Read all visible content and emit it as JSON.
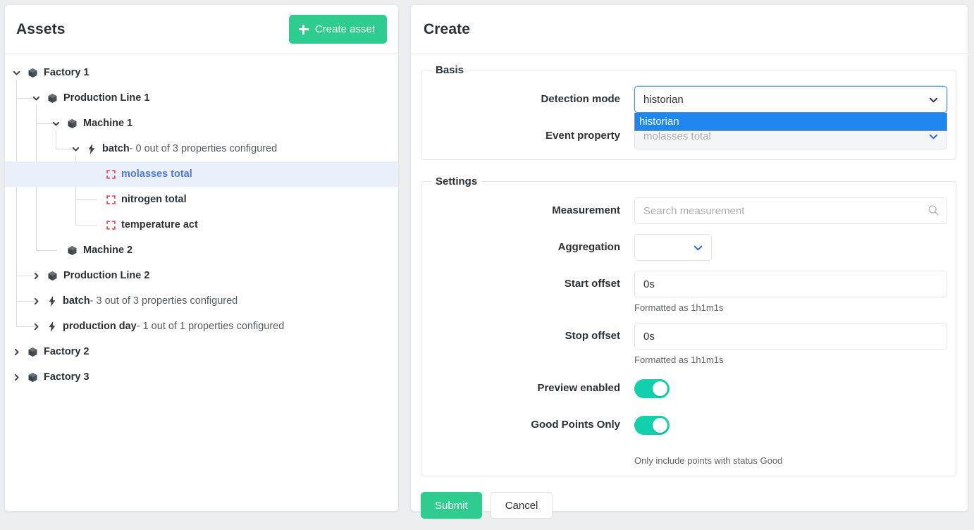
{
  "assets_panel": {
    "title": "Assets",
    "create_button": "Create asset",
    "create_icon": "plus-icon",
    "tree": [
      {
        "id": "factory1",
        "depth": 0,
        "icon": "cube-icon",
        "twisty": "chevron-down-icon",
        "label": "Factory 1",
        "suffix": ""
      },
      {
        "id": "pline1",
        "depth": 1,
        "icon": "cube-icon",
        "twisty": "chevron-down-icon",
        "label": "Production Line 1",
        "suffix": ""
      },
      {
        "id": "machine1",
        "depth": 2,
        "icon": "cube-icon",
        "twisty": "chevron-down-icon",
        "label": "Machine 1",
        "suffix": ""
      },
      {
        "id": "batch1",
        "depth": 3,
        "icon": "bolt-icon",
        "twisty": "chevron-down-icon",
        "label": "batch",
        "suffix": " - 0 out of 3 properties configured"
      },
      {
        "id": "molasses",
        "depth": 4,
        "icon": "property-icon",
        "twisty": "",
        "label": "molasses total",
        "suffix": "",
        "selected": true
      },
      {
        "id": "nitrogen",
        "depth": 4,
        "icon": "property-icon",
        "twisty": "",
        "label": "nitrogen total",
        "suffix": ""
      },
      {
        "id": "temp",
        "depth": 4,
        "icon": "property-icon",
        "twisty": "",
        "label": "temperature act",
        "suffix": ""
      },
      {
        "id": "machine2",
        "depth": 2,
        "icon": "cube-icon",
        "twisty": "",
        "label": "Machine 2",
        "suffix": ""
      },
      {
        "id": "pline2",
        "depth": 1,
        "icon": "cube-icon",
        "twisty": "chevron-right-icon",
        "label": "Production Line 2",
        "suffix": ""
      },
      {
        "id": "batch2",
        "depth": 1,
        "icon": "bolt-icon",
        "twisty": "chevron-right-icon",
        "label": "batch",
        "suffix": " - 3 out of 3 properties configured"
      },
      {
        "id": "prodday",
        "depth": 1,
        "icon": "bolt-icon",
        "twisty": "chevron-right-icon",
        "label": "production day",
        "suffix": " - 1 out of 1 properties configured"
      },
      {
        "id": "factory2",
        "depth": 0,
        "icon": "cube-icon",
        "twisty": "chevron-right-icon",
        "label": "Factory 2",
        "suffix": ""
      },
      {
        "id": "factory3",
        "depth": 0,
        "icon": "cube-icon",
        "twisty": "chevron-right-icon",
        "label": "Factory 3",
        "suffix": ""
      }
    ]
  },
  "create_panel": {
    "title": "Create",
    "basis": {
      "legend": "Basis",
      "detection_mode": {
        "label": "Detection mode",
        "value": "historian",
        "open": true,
        "options": [
          "historian"
        ],
        "selected_option": "historian"
      },
      "event_property": {
        "label": "Event property",
        "value": "molasses total",
        "disabled": true
      }
    },
    "settings": {
      "legend": "Settings",
      "measurement": {
        "label": "Measurement",
        "value": "",
        "placeholder": "Search measurement",
        "icon": "search-icon"
      },
      "aggregation": {
        "label": "Aggregation",
        "value": ""
      },
      "start_offset": {
        "label": "Start offset",
        "value": "0s",
        "hint": "Formatted as 1h1m1s"
      },
      "stop_offset": {
        "label": "Stop offset",
        "value": "0s",
        "hint": "Formatted as 1h1m1s"
      },
      "preview_enabled": {
        "label": "Preview enabled",
        "on": true
      },
      "good_points_only": {
        "label": "Good Points Only",
        "on": true,
        "hint": "Only include points with status Good"
      }
    },
    "submit_label": "Submit",
    "cancel_label": "Cancel"
  },
  "colors": {
    "accent_green": "#2ecc8f",
    "toggle_on": "#10d0ad",
    "focus_blue": "#4a90e8",
    "option_highlight": "#1f87f0",
    "selected_row": "#eaf0fb",
    "property_icon_red": "#e8535a",
    "link_blue": "#4f7bd6"
  }
}
